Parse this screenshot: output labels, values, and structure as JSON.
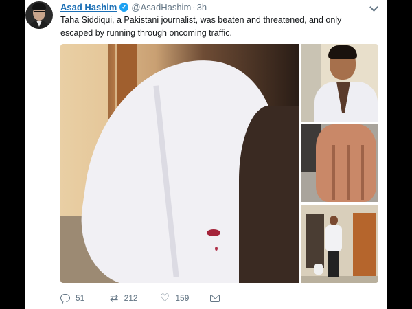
{
  "tweet": {
    "author_name": "Asad Hashim",
    "handle": "@AsadHashim",
    "separator": "·",
    "time": "3h",
    "text": "Taha Siddiqui, a Pakistani journalist,  was beaten and threatened, and only escaped by running through oncoming traffic.",
    "verified_icon": "verified-check-icon",
    "menu_icon": "chevron-down-icon"
  },
  "actions": {
    "reply_icon": "reply-icon",
    "reply_count": "51",
    "retweet_icon": "retweet-icon",
    "retweet_glyph": "⇄",
    "retweet_count": "212",
    "like_icon": "heart-icon",
    "like_glyph": "♡",
    "like_count": "159",
    "dm_icon": "envelope-icon"
  },
  "colors": {
    "name": "#1b6fb5",
    "muted": "#657786",
    "verified": "#1da1f2",
    "background": "#ffffff",
    "frame": "#000000"
  }
}
